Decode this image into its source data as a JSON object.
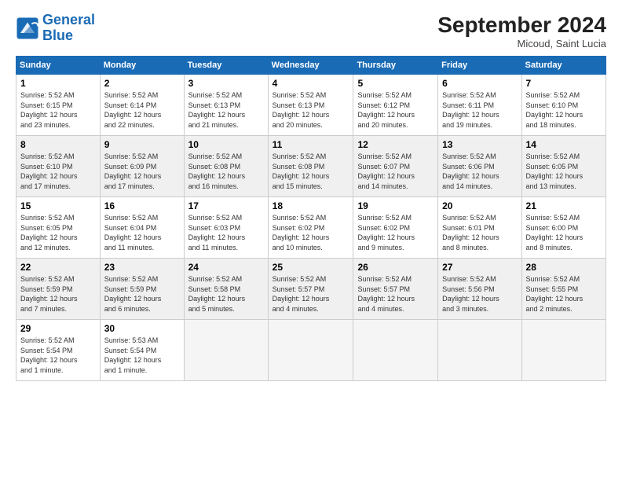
{
  "header": {
    "logo_line1": "General",
    "logo_line2": "Blue",
    "month_title": "September 2024",
    "location": "Micoud, Saint Lucia"
  },
  "weekdays": [
    "Sunday",
    "Monday",
    "Tuesday",
    "Wednesday",
    "Thursday",
    "Friday",
    "Saturday"
  ],
  "weeks": [
    [
      {
        "day": "1",
        "sunrise": "5:52 AM",
        "sunset": "6:15 PM",
        "daylight": "12 hours and 23 minutes."
      },
      {
        "day": "2",
        "sunrise": "5:52 AM",
        "sunset": "6:14 PM",
        "daylight": "12 hours and 22 minutes."
      },
      {
        "day": "3",
        "sunrise": "5:52 AM",
        "sunset": "6:13 PM",
        "daylight": "12 hours and 21 minutes."
      },
      {
        "day": "4",
        "sunrise": "5:52 AM",
        "sunset": "6:13 PM",
        "daylight": "12 hours and 20 minutes."
      },
      {
        "day": "5",
        "sunrise": "5:52 AM",
        "sunset": "6:12 PM",
        "daylight": "12 hours and 20 minutes."
      },
      {
        "day": "6",
        "sunrise": "5:52 AM",
        "sunset": "6:11 PM",
        "daylight": "12 hours and 19 minutes."
      },
      {
        "day": "7",
        "sunrise": "5:52 AM",
        "sunset": "6:10 PM",
        "daylight": "12 hours and 18 minutes."
      }
    ],
    [
      {
        "day": "8",
        "sunrise": "5:52 AM",
        "sunset": "6:10 PM",
        "daylight": "12 hours and 17 minutes."
      },
      {
        "day": "9",
        "sunrise": "5:52 AM",
        "sunset": "6:09 PM",
        "daylight": "12 hours and 17 minutes."
      },
      {
        "day": "10",
        "sunrise": "5:52 AM",
        "sunset": "6:08 PM",
        "daylight": "12 hours and 16 minutes."
      },
      {
        "day": "11",
        "sunrise": "5:52 AM",
        "sunset": "6:08 PM",
        "daylight": "12 hours and 15 minutes."
      },
      {
        "day": "12",
        "sunrise": "5:52 AM",
        "sunset": "6:07 PM",
        "daylight": "12 hours and 14 minutes."
      },
      {
        "day": "13",
        "sunrise": "5:52 AM",
        "sunset": "6:06 PM",
        "daylight": "12 hours and 14 minutes."
      },
      {
        "day": "14",
        "sunrise": "5:52 AM",
        "sunset": "6:05 PM",
        "daylight": "12 hours and 13 minutes."
      }
    ],
    [
      {
        "day": "15",
        "sunrise": "5:52 AM",
        "sunset": "6:05 PM",
        "daylight": "12 hours and 12 minutes."
      },
      {
        "day": "16",
        "sunrise": "5:52 AM",
        "sunset": "6:04 PM",
        "daylight": "12 hours and 11 minutes."
      },
      {
        "day": "17",
        "sunrise": "5:52 AM",
        "sunset": "6:03 PM",
        "daylight": "12 hours and 11 minutes."
      },
      {
        "day": "18",
        "sunrise": "5:52 AM",
        "sunset": "6:02 PM",
        "daylight": "12 hours and 10 minutes."
      },
      {
        "day": "19",
        "sunrise": "5:52 AM",
        "sunset": "6:02 PM",
        "daylight": "12 hours and 9 minutes."
      },
      {
        "day": "20",
        "sunrise": "5:52 AM",
        "sunset": "6:01 PM",
        "daylight": "12 hours and 8 minutes."
      },
      {
        "day": "21",
        "sunrise": "5:52 AM",
        "sunset": "6:00 PM",
        "daylight": "12 hours and 8 minutes."
      }
    ],
    [
      {
        "day": "22",
        "sunrise": "5:52 AM",
        "sunset": "5:59 PM",
        "daylight": "12 hours and 7 minutes."
      },
      {
        "day": "23",
        "sunrise": "5:52 AM",
        "sunset": "5:59 PM",
        "daylight": "12 hours and 6 minutes."
      },
      {
        "day": "24",
        "sunrise": "5:52 AM",
        "sunset": "5:58 PM",
        "daylight": "12 hours and 5 minutes."
      },
      {
        "day": "25",
        "sunrise": "5:52 AM",
        "sunset": "5:57 PM",
        "daylight": "12 hours and 4 minutes."
      },
      {
        "day": "26",
        "sunrise": "5:52 AM",
        "sunset": "5:57 PM",
        "daylight": "12 hours and 4 minutes."
      },
      {
        "day": "27",
        "sunrise": "5:52 AM",
        "sunset": "5:56 PM",
        "daylight": "12 hours and 3 minutes."
      },
      {
        "day": "28",
        "sunrise": "5:52 AM",
        "sunset": "5:55 PM",
        "daylight": "12 hours and 2 minutes."
      }
    ],
    [
      {
        "day": "29",
        "sunrise": "5:52 AM",
        "sunset": "5:54 PM",
        "daylight": "12 hours and 1 minute."
      },
      {
        "day": "30",
        "sunrise": "5:53 AM",
        "sunset": "5:54 PM",
        "daylight": "12 hours and 1 minute."
      },
      null,
      null,
      null,
      null,
      null
    ]
  ]
}
